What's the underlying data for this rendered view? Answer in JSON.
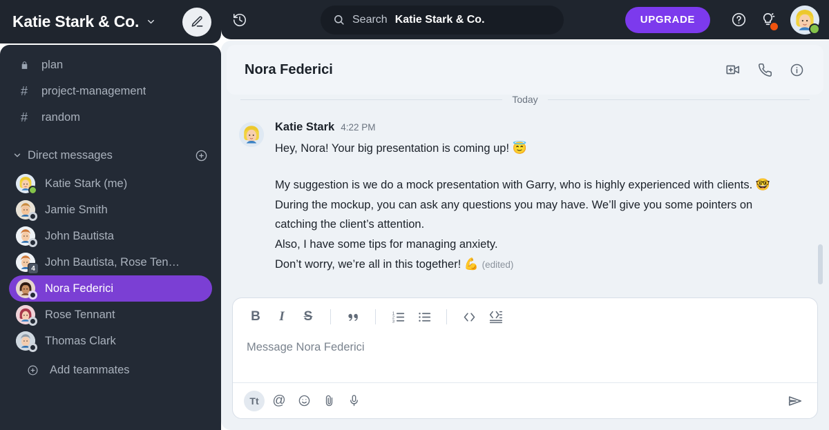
{
  "workspace": {
    "title": "Katie Stark & Co.",
    "chevron_icon": "chevron-down-icon",
    "compose_icon": "pencil-icon"
  },
  "topbar": {
    "history_icon": "history-clock-icon",
    "search": {
      "icon": "search-icon",
      "placeholder": "Search",
      "scope": "Katie Stark & Co."
    },
    "upgrade_label": "UPGRADE",
    "help_icon": "question-circle-icon",
    "tips_icon": "lightbulb-icon",
    "notification_dot_color": "#f0530e",
    "avatar_name": "Katie Stark",
    "avatar_status": "online"
  },
  "sidebar": {
    "channels": [
      {
        "label": "plan",
        "glyph": "lock-icon",
        "type": "private"
      },
      {
        "label": "project-management",
        "glyph": "hash-icon",
        "type": "public"
      },
      {
        "label": "random",
        "glyph": "hash-icon",
        "type": "public"
      }
    ],
    "dm_section": {
      "title": "Direct messages",
      "collapse_icon": "chevron-down-icon",
      "add_icon": "plus-circle-icon"
    },
    "dms": [
      {
        "label": "Katie Stark (me)",
        "status": "online",
        "selected": false,
        "avatar": "katie"
      },
      {
        "label": "Jamie Smith",
        "status": "offline",
        "selected": false,
        "avatar": "jamie"
      },
      {
        "label": "John Bautista",
        "status": "offline",
        "selected": false,
        "avatar": "john"
      },
      {
        "label": "John Bautista, Rose Ten…",
        "status": "group",
        "count": "4",
        "selected": false,
        "avatar": "john"
      },
      {
        "label": "Nora Federici",
        "status": "offline",
        "selected": true,
        "avatar": "nora"
      },
      {
        "label": "Rose Tennant",
        "status": "offline",
        "selected": false,
        "avatar": "rose"
      },
      {
        "label": "Thomas Clark",
        "status": "offline",
        "selected": false,
        "avatar": "thomas"
      }
    ],
    "add_teammates": {
      "label": "Add teammates",
      "icon": "plus-circle-icon"
    },
    "selected_color": "#7b3fd4"
  },
  "chat": {
    "title": "Nora Federici",
    "actions": [
      {
        "name": "add-video-call-icon"
      },
      {
        "name": "phone-call-icon"
      },
      {
        "name": "info-icon"
      }
    ],
    "day_divider": "Today",
    "messages": [
      {
        "author": "Katie Stark",
        "time": "4:22 PM",
        "avatar": "katie",
        "lines": [
          {
            "text": "Hey, Nora! Your big presentation is coming up! ",
            "emoji": "😇"
          }
        ]
      }
    ],
    "second_block": {
      "line1_a": "My suggestion is we do a mock presentation with Garry, who is highly experienced with clients. ",
      "line1_emoji": "🤓",
      "line2": "During the mockup, you can ask any questions you may have. We’ll give you some pointers on",
      "line3": "catching the client’s attention.",
      "line4": "Also, I have some tips for managing anxiety.",
      "line5_a": "Don’t worry, we’re all in this together! ",
      "line5_emoji": "💪",
      "edited_label": "(edited)"
    }
  },
  "composer": {
    "placeholder": "Message Nora Federici",
    "format_buttons": [
      {
        "name": "bold-icon",
        "label": "B"
      },
      {
        "name": "italic-icon",
        "label": "I"
      },
      {
        "name": "strikethrough-icon",
        "label": "S"
      },
      {
        "name": "blockquote-icon",
        "label": "“"
      },
      {
        "name": "ordered-list-icon",
        "label": ""
      },
      {
        "name": "bullet-list-icon",
        "label": ""
      },
      {
        "name": "inline-code-icon",
        "label": ""
      },
      {
        "name": "code-block-icon",
        "label": ""
      }
    ],
    "tool_buttons": [
      {
        "name": "text-format-icon",
        "label": "Tt",
        "active": true
      },
      {
        "name": "mention-icon",
        "label": "@",
        "active": false
      },
      {
        "name": "emoji-icon",
        "label": "",
        "active": false
      },
      {
        "name": "attachment-icon",
        "label": "",
        "active": false
      },
      {
        "name": "microphone-icon",
        "label": "",
        "active": false
      }
    ],
    "send_icon": "send-icon"
  }
}
